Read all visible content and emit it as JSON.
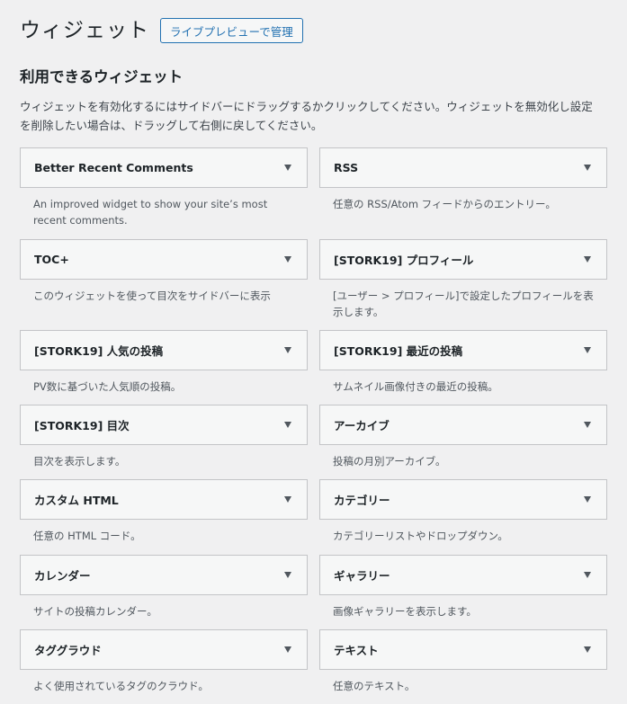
{
  "header": {
    "title": "ウィジェット",
    "manage_button": "ライブプレビューで管理"
  },
  "available": {
    "title": "利用できるウィジェット",
    "description": "ウィジェットを有効化するにはサイドバーにドラッグするかクリックしてください。ウィジェットを無効化し設定を削除したい場合は、ドラッグして右側に戻してください。"
  },
  "widgets": [
    {
      "title": "Better Recent Comments",
      "description": "An improved widget to show your site’s most recent comments."
    },
    {
      "title": "RSS",
      "description": "任意の RSS/Atom フィードからのエントリー。"
    },
    {
      "title": "TOC+",
      "description": "このウィジェットを使って目次をサイドバーに表示"
    },
    {
      "title": "[STORK19] プロフィール",
      "description": "[ユーザー > プロフィール]で設定したプロフィールを表示します。"
    },
    {
      "title": "[STORK19] 人気の投稿",
      "description": "PV数に基づいた人気順の投稿。"
    },
    {
      "title": "[STORK19] 最近の投稿",
      "description": "サムネイル画像付きの最近の投稿。"
    },
    {
      "title": "[STORK19] 目次",
      "description": "目次を表示します。"
    },
    {
      "title": "アーカイブ",
      "description": "投稿の月別アーカイブ。"
    },
    {
      "title": "カスタム HTML",
      "description": "任意の HTML コード。"
    },
    {
      "title": "カテゴリー",
      "description": "カテゴリーリストやドロップダウン。"
    },
    {
      "title": "カレンダー",
      "description": "サイトの投稿カレンダー。"
    },
    {
      "title": "ギャラリー",
      "description": "画像ギャラリーを表示します。"
    },
    {
      "title": "タググラウド",
      "description": "よく使用されているタグのクラウド。"
    },
    {
      "title": "テキスト",
      "description": "任意のテキスト。"
    }
  ],
  "icons": {
    "toggle": "triangle-down-icon"
  },
  "colors": {
    "accent": "#2271b1",
    "background": "#f0f0f1",
    "widget_bar": "#f6f7f7",
    "border": "#c3c4c7"
  }
}
